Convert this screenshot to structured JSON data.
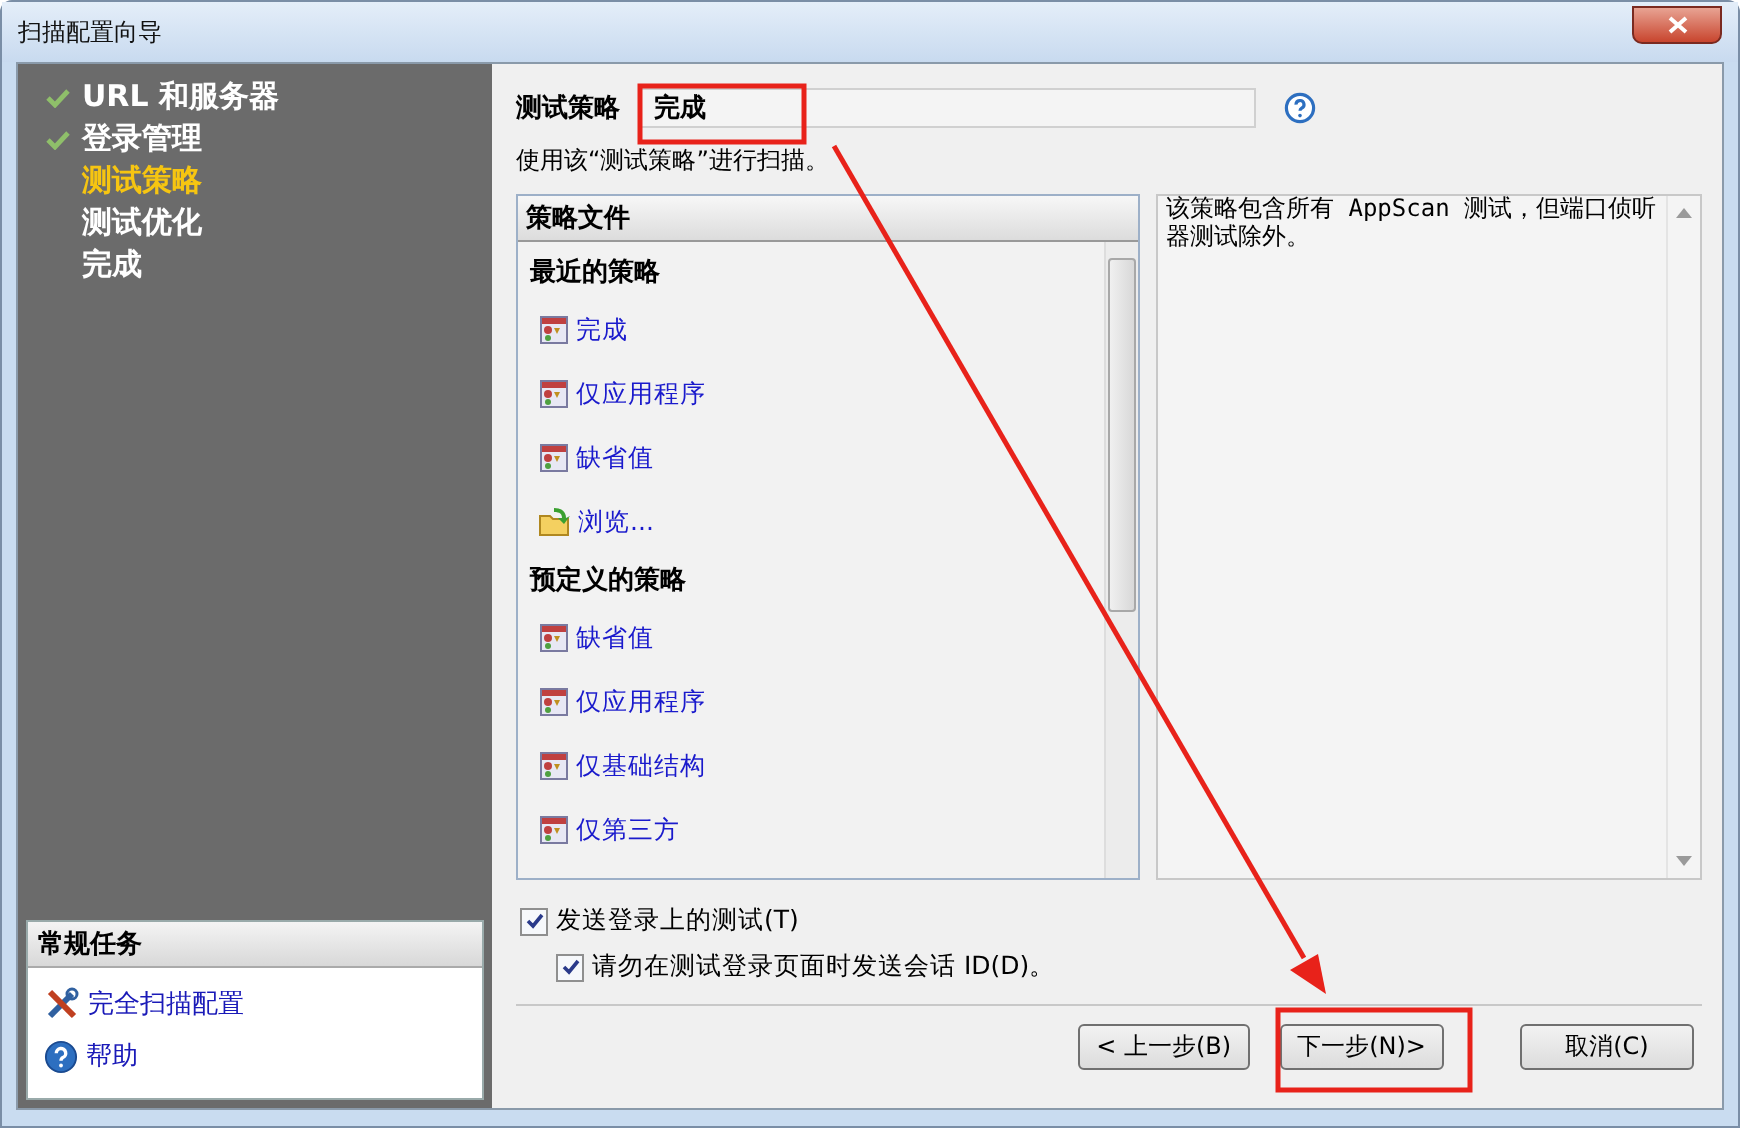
{
  "window": {
    "title": "扫描配置向导"
  },
  "steps": [
    {
      "label": "URL 和服务器",
      "done": true,
      "selected": false
    },
    {
      "label": "登录管理",
      "done": true,
      "selected": false
    },
    {
      "label": "测试策略",
      "done": false,
      "selected": true
    },
    {
      "label": "测试优化",
      "done": false,
      "selected": false
    },
    {
      "label": "完成",
      "done": false,
      "selected": false
    }
  ],
  "tasks": {
    "title": "常规任务",
    "items": [
      {
        "label": "完全扫描配置",
        "kind": "tools"
      },
      {
        "label": "帮助",
        "kind": "help"
      }
    ]
  },
  "policy_field": {
    "label": "测试策略",
    "value": "完成"
  },
  "hint": "使用该“测试策略”进行扫描。",
  "policy_list": {
    "header": "策略文件",
    "groups": [
      {
        "title": "最近的策略",
        "items": [
          {
            "label": "完成",
            "kind": "policy"
          },
          {
            "label": "仅应用程序",
            "kind": "policy"
          },
          {
            "label": "缺省值",
            "kind": "policy"
          },
          {
            "label": "浏览...",
            "kind": "browse"
          }
        ]
      },
      {
        "title": "预定义的策略",
        "items": [
          {
            "label": "缺省值",
            "kind": "policy"
          },
          {
            "label": "仅应用程序",
            "kind": "policy"
          },
          {
            "label": "仅基础结构",
            "kind": "policy"
          },
          {
            "label": "仅第三方",
            "kind": "policy"
          }
        ]
      }
    ]
  },
  "description": "该策略包含所有 AppScan 测试，但端口侦听器测试除外。",
  "checkboxes": [
    {
      "label": "发送登录上的测试(T)",
      "checked": true,
      "children": [
        {
          "label": "请勿在测试登录页面时发送会话 ID(D)。",
          "checked": true
        }
      ]
    }
  ],
  "buttons": [
    "< 上一步(B)",
    "下一步(N)>",
    "取消(C)"
  ]
}
